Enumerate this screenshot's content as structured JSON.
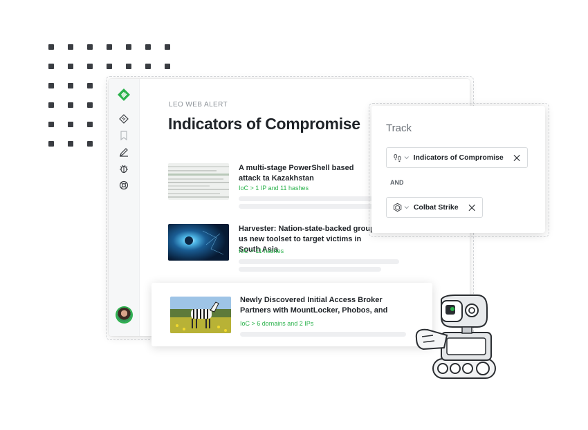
{
  "app": {
    "overline": "LEO WEB ALERT",
    "title": "Indicators of Compromise"
  },
  "sidebar": {
    "icons": [
      "feedly-logo-icon",
      "leo-icon",
      "bookmark-icon",
      "pencil-icon",
      "bug-icon",
      "lifebuoy-icon"
    ],
    "avatar": "user-avatar"
  },
  "articles": [
    {
      "title": "A multi-stage PowerShell based attack ta Kazakhstan",
      "ioc": "IoC > 1 IP and 11 hashes"
    },
    {
      "title": "Harvester: Nation-state-backed group us new toolset to target victims in South Asia",
      "ioc": "IoC > 11 hashes"
    },
    {
      "title": "Newly Discovered Initial Access Broker Partners with MountLocker, Phobos, and",
      "ioc": "IoC >  6 domains and 2 IPs"
    }
  ],
  "track": {
    "title": "Track",
    "chip1": "Indicators of Compromise",
    "and": "AND",
    "chip2": "Colbat Strike"
  },
  "colors": {
    "accent": "#2bb24c",
    "text": "#1f2328",
    "muted": "#8a9096"
  }
}
